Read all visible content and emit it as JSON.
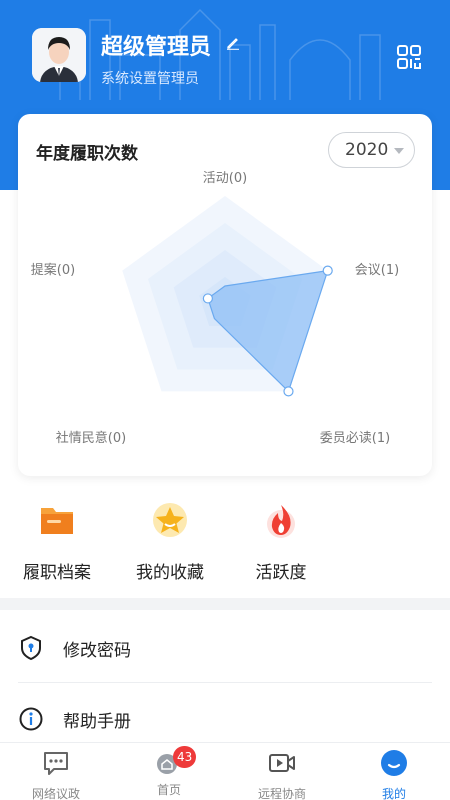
{
  "profile": {
    "name": "超级管理员",
    "role": "系统设置管理员"
  },
  "activity_card": {
    "title": "年度履职次数",
    "year": "2020",
    "axes": [
      {
        "label": "活动(0)",
        "value": 0
      },
      {
        "label": "会议(1)",
        "value": 1
      },
      {
        "label": "委员必读(1)",
        "value": 1
      },
      {
        "label": "社情民意(0)",
        "value": 0
      },
      {
        "label": "提案(0)",
        "value": 0
      }
    ],
    "max": 1
  },
  "quick_actions": [
    {
      "label": "履职档案",
      "icon": "folder-icon"
    },
    {
      "label": "我的收藏",
      "icon": "star-icon"
    },
    {
      "label": "活跃度",
      "icon": "flame-icon"
    }
  ],
  "menu": [
    {
      "label": "修改密码",
      "icon": "shield-lock-icon"
    },
    {
      "label": "帮助手册",
      "icon": "info-icon"
    }
  ],
  "tabs": [
    {
      "label": "网络议政",
      "icon": "chat-icon"
    },
    {
      "label": "首页",
      "icon": "home-icon",
      "badge": "43"
    },
    {
      "label": "远程协商",
      "icon": "video-icon"
    },
    {
      "label": "我的",
      "icon": "profile-icon",
      "active": true
    }
  ],
  "colors": {
    "primary": "#1f7de6",
    "radar_fill": "#8fbff5",
    "badge": "#ee3a3a"
  }
}
